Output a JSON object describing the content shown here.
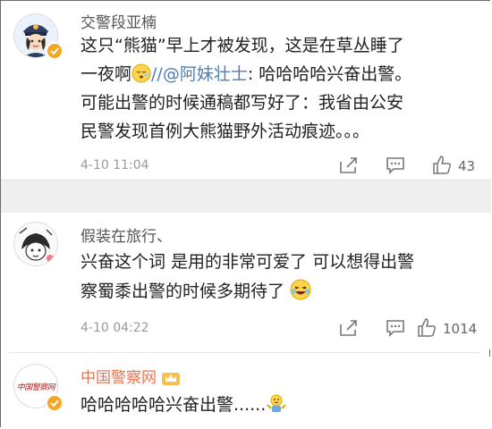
{
  "comments": [
    {
      "user": "交警段亚楠",
      "lines": [
        "这只“熊猫”早上才被发现，这是在草丛睡了",
        "一夜啊",
        "可能出警的时候通稿都写好了：我省由公安",
        "民警发现首例大熊猫野外活动痕迹。。。"
      ],
      "repost_sep": "//",
      "mention": "@阿妹壮士",
      "repost_text": ": 哈哈哈哈兴奋出警。",
      "emoji": "sleepy-face-emoji",
      "time": "4-10 11:04",
      "likes": "43"
    },
    {
      "user": "假装在旅行、",
      "lines": [
        "兴奋这个词 是用的非常可爱了  可以想得出警",
        "察蜀黍出警的时候多期待了"
      ],
      "emoji": "laughing-tears-emoji",
      "time": "4-10 04:22",
      "likes": "1014"
    },
    {
      "user": "中国警察网",
      "avatar_text": "中国警察网",
      "text": "哈哈哈哈哈兴奋出警......",
      "emoji": "shrug-emoji",
      "badge": "crown-icon"
    }
  ],
  "colors": {
    "accent_name": "#eb7350",
    "link": "#507daf",
    "badge": "#f5a623"
  }
}
